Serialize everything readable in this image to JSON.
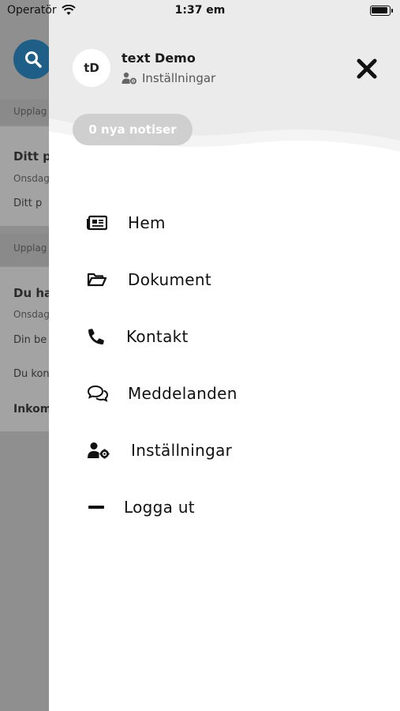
{
  "status_bar": {
    "carrier": "Operatör",
    "time": "1:37 em"
  },
  "background": {
    "items": [
      "Upplag",
      "Ditt p",
      "Onsdag",
      "Ditt p",
      "Upplag",
      "Du ha",
      "Onsdag",
      "Din be",
      "Du kon",
      "Inkom"
    ]
  },
  "drawer": {
    "avatar_initials": "tD",
    "user_name": "text Demo",
    "settings_label": "Inställningar",
    "notices": "0 nya notiser",
    "menu": [
      {
        "label": "Hem",
        "icon": "newspaper-icon"
      },
      {
        "label": "Dokument",
        "icon": "folder-open-icon"
      },
      {
        "label": "Kontakt",
        "icon": "phone-icon"
      },
      {
        "label": "Meddelanden",
        "icon": "chat-bubbles-icon"
      },
      {
        "label": "Inställningar",
        "icon": "user-gear-icon"
      },
      {
        "label": "Logga ut",
        "icon": "minus-icon"
      }
    ]
  },
  "colors": {
    "header_bg": "#ebebeb",
    "pill_bg": "#cfcfcf",
    "overlay": "#8f8f8f",
    "search_button": "#1f5e86"
  }
}
